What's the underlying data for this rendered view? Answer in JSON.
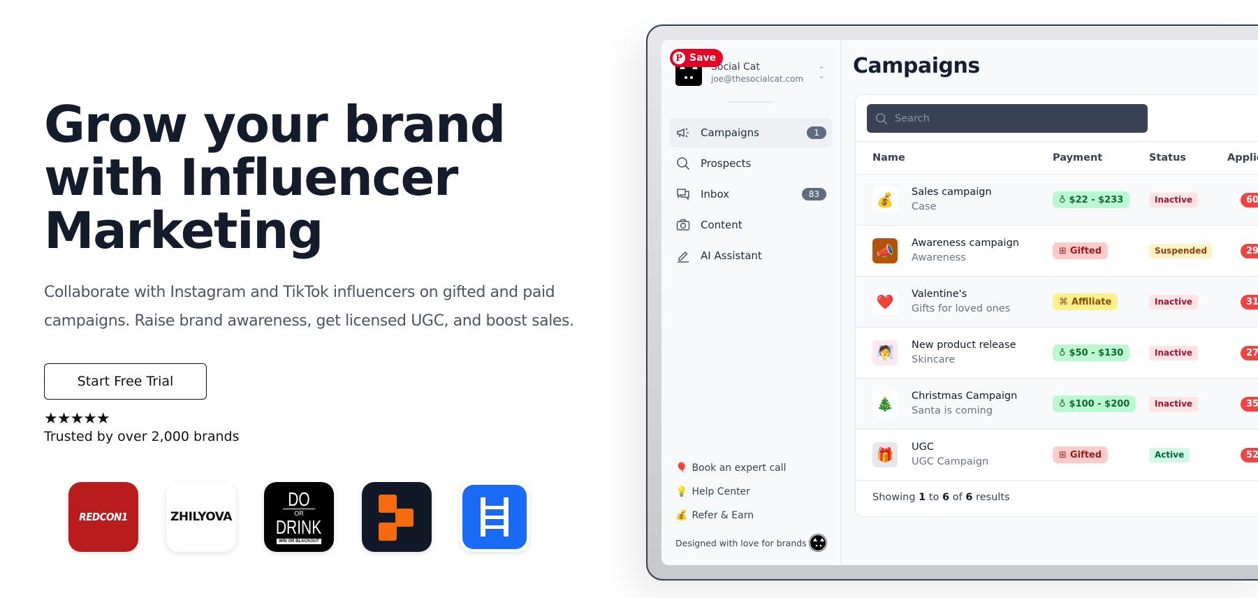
{
  "hero": {
    "title": "Grow your brand with Influencer Marketing",
    "title_lines": [
      "Grow your brand",
      "with Influencer",
      "Marketing"
    ],
    "subtitle": "Collaborate with Instagram and TikTok influencers on gifted and paid campaigns. Raise brand awareness, get licensed UGC, and boost sales.",
    "cta_label": "Start Free Trial",
    "rating_stars": "★★★★★",
    "rating_value": 5,
    "trusted_text": "Trusted by over 2,000 brands"
  },
  "brands": [
    {
      "name": "REDCON1",
      "label": "REDCON1"
    },
    {
      "name": "ZHILYOVA",
      "label": "ZHILYOVA"
    },
    {
      "name": "Do or Drink",
      "lines": [
        "DO",
        "OR",
        "DRINK",
        "WIN OR BLACKOUT"
      ]
    },
    {
      "name": "Replo",
      "label": ""
    },
    {
      "name": "Ladder",
      "label": ""
    }
  ],
  "pinterest": {
    "save_label": "Save",
    "icon": "P"
  },
  "app": {
    "account": {
      "name": "Social Cat",
      "email": "joe@thesocialcat.com"
    },
    "nav": [
      {
        "label": "Campaigns",
        "icon": "megaphone-icon",
        "badge": "1",
        "active": true
      },
      {
        "label": "Prospects",
        "icon": "search-icon",
        "badge": null,
        "active": false
      },
      {
        "label": "Inbox",
        "icon": "chat-icon",
        "badge": "83",
        "active": false
      },
      {
        "label": "Content",
        "icon": "camera-icon",
        "badge": null,
        "active": false
      },
      {
        "label": "AI Assistant",
        "icon": "pencil-icon",
        "badge": null,
        "active": false
      }
    ],
    "extras": [
      {
        "emoji": "🎈",
        "label": "Book an expert call"
      },
      {
        "emoji": "💡",
        "label": "Help Center"
      },
      {
        "emoji": "💰",
        "label": "Refer & Earn"
      }
    ],
    "footer_text": "Designed with love for brands",
    "page_title": "Campaigns",
    "search": {
      "placeholder": "Search",
      "value": ""
    },
    "table": {
      "columns": [
        "Name",
        "Payment",
        "Status",
        "Applica"
      ],
      "rows": [
        {
          "thumb": "💰",
          "name": "Sales campaign",
          "sub": "Case",
          "payment": "$22 - $233",
          "payment_type": "paid",
          "status": "Inactive",
          "applications": "60"
        },
        {
          "thumb": "📣",
          "name": "Awareness campaign",
          "sub": "Awareness",
          "payment": "Gifted",
          "payment_type": "gifted",
          "status": "Suspended",
          "applications": "29"
        },
        {
          "thumb": "❤️",
          "name": "Valentine's",
          "sub": "Gifts for loved ones",
          "payment": "Affiliate",
          "payment_type": "affiliate",
          "status": "Inactive",
          "applications": "31"
        },
        {
          "thumb": "🧖",
          "name": "New product release",
          "sub": "Skincare",
          "payment": "$50 - $130",
          "payment_type": "paid",
          "status": "Inactive",
          "applications": "27"
        },
        {
          "thumb": "🎄",
          "name": "Christmas Campaign",
          "sub": "Santa is coming",
          "payment": "$100 - $200",
          "payment_type": "paid",
          "status": "Inactive",
          "applications": "35"
        },
        {
          "thumb": "🎁",
          "name": "UGC",
          "sub": "UGC Campaign",
          "payment": "Gifted",
          "payment_type": "gifted",
          "status": "Active",
          "applications": "52"
        }
      ],
      "footer": {
        "prefix": "Showing",
        "from": "1",
        "to_word": "to",
        "to": "6",
        "of_word": "of",
        "total": "6",
        "suffix": "results"
      }
    }
  },
  "colors": {
    "heading": "#141b2b",
    "pinterest_red": "#e60023",
    "search_bg": "#394254",
    "nav_badge": "#5f6b7f",
    "application_badge": "#ef4444"
  }
}
